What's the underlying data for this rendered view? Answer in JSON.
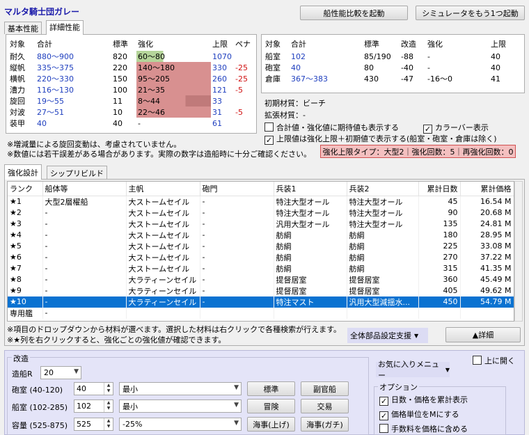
{
  "app_title": "マルタ騎士団ガレー",
  "top_buttons": {
    "compare": "船性能比較を起動",
    "simulator": "シミュレータをもう1つ起動"
  },
  "perf_tabs": [
    "基本性能",
    "詳細性能"
  ],
  "stats": {
    "headers": [
      "対象",
      "合計",
      "標準",
      "強化",
      "上限",
      "ペナ"
    ],
    "rows": [
      {
        "name": "耐久",
        "total": "880～900",
        "std": "820",
        "enh": "60～80",
        "cap": "1070",
        "pen": "",
        "bar": 0.36,
        "color": "green"
      },
      {
        "name": "縦帆",
        "total": "335～375",
        "std": "220",
        "enh": "140～180",
        "cap": "330",
        "pen": "-25",
        "bar": 1.0,
        "color": "red"
      },
      {
        "name": "横帆",
        "total": "220～330",
        "std": "150",
        "enh": "95～205",
        "cap": "260",
        "pen": "-25",
        "bar": 1.0,
        "color": "red"
      },
      {
        "name": "漕力",
        "total": "116～130",
        "std": "100",
        "enh": "21～35",
        "cap": "121",
        "pen": "-5",
        "bar": 1.0,
        "color": "red"
      },
      {
        "name": "旋回",
        "total": "19～55",
        "std": "11",
        "enh": "8～44",
        "cap": "33",
        "pen": "",
        "bar": 0.66,
        "color": "red"
      },
      {
        "name": "対波",
        "total": "27～51",
        "std": "10",
        "enh": "22～46",
        "cap": "31",
        "pen": "-5",
        "bar": 1.0,
        "color": "red"
      },
      {
        "name": "装甲",
        "total": "40",
        "std": "40",
        "enh": "-",
        "cap": "61",
        "pen": "",
        "bar": 0,
        "color": "none"
      }
    ]
  },
  "notes_top": [
    "※増減量による旋回変動は、考慮されていません。",
    "※数値には若干誤差がある場合があります。実際の数字は造船時に十分ご確認ください。"
  ],
  "capacity": {
    "headers": [
      "対象",
      "合計",
      "標準",
      "改造",
      "強化",
      "上限"
    ],
    "rows": [
      {
        "name": "船室",
        "total": "102",
        "std": "85/190",
        "mod": "-88",
        "enh": "-",
        "cap": "40"
      },
      {
        "name": "砲室",
        "total": "40",
        "std": "80",
        "mod": "-40",
        "enh": "-",
        "cap": "40"
      },
      {
        "name": "倉庫",
        "total": "367～383",
        "std": "430",
        "mod": "-47",
        "enh": "-16～0",
        "cap": "41"
      }
    ]
  },
  "material": {
    "initial_label": "初期材質：",
    "initial_value": "ビーチ",
    "ext_label": "拡張材質：",
    "ext_value": "-"
  },
  "options_top": {
    "expect": "合計値・強化値に期待値も表示する",
    "colorbar": "カラーバー表示",
    "capmode": "上限値は強化上限＋初期値で表示する(船室・砲室・倉庫は除く)"
  },
  "enh_info": "強化上限タイプ：大型2｜強化回数：5｜再強化回数：0",
  "enh_tabs": [
    "強化設計",
    "シップリビルド"
  ],
  "grid": {
    "headers": [
      "ランク",
      "船体等",
      "主帆",
      "砲門",
      "兵装1",
      "兵装2",
      "累計日数",
      "累計価格"
    ],
    "rows": [
      [
        "★1",
        "大型2層櫂船",
        "大ストームセイル",
        "-",
        "特注大型オール",
        "特注大型オール",
        "45",
        "16.54 M"
      ],
      [
        "★2",
        "-",
        "大ストームセイル",
        "-",
        "特注大型オール",
        "特注大型オール",
        "90",
        "20.68 M"
      ],
      [
        "★3",
        "-",
        "大ストームセイル",
        "-",
        "汎用大型オール",
        "特注大型オール",
        "135",
        "24.81 M"
      ],
      [
        "★4",
        "-",
        "大ストームセイル",
        "-",
        "舫綱",
        "舫綱",
        "180",
        "28.95 M"
      ],
      [
        "★5",
        "-",
        "大ストームセイル",
        "-",
        "舫綱",
        "舫綱",
        "225",
        "33.08 M"
      ],
      [
        "★6",
        "-",
        "大ストームセイル",
        "-",
        "舫綱",
        "舫綱",
        "270",
        "37.22 M"
      ],
      [
        "★7",
        "-",
        "大ストームセイル",
        "-",
        "舫綱",
        "舫綱",
        "315",
        "41.35 M"
      ],
      [
        "★8",
        "-",
        "大ラティーンセイル",
        "-",
        "提督居室",
        "提督居室",
        "360",
        "45.49 M"
      ],
      [
        "★9",
        "-",
        "大ラティーンセイル",
        "-",
        "提督居室",
        "提督居室",
        "405",
        "49.62 M"
      ],
      [
        "★10",
        "-",
        "大ラティーンセイル",
        "-",
        "特注マスト",
        "汎用大型減揺水...",
        "450",
        "54.79 M"
      ],
      [
        "専用艦",
        "-",
        "",
        "",
        "",
        "",
        "",
        ""
      ]
    ]
  },
  "notes_bottom": [
    "※項目のドロップダウンから材料が選べます。選択した材料は右クリックで各種検索が行えます。",
    "※★列を右クリックすると、強化ごとの強化値が確認できます。"
  ],
  "support_button": "全体部品設定支援",
  "detail_button": "▲詳細",
  "mod": {
    "title": "改造",
    "ship_r_label": "造船R",
    "ship_r_value": "20",
    "rows": [
      {
        "label": "砲室 (40-120)",
        "value": "40",
        "select": "最小",
        "b1": "標準",
        "b2": "副官船"
      },
      {
        "label": "船室 (102-285)",
        "value": "102",
        "select": "最小",
        "b1": "冒険",
        "b2": "交易"
      },
      {
        "label": "容量 (525-875)",
        "value": "525",
        "select": "-25%",
        "b1": "海事(上げ)",
        "b2": "海事(ガチ)"
      }
    ]
  },
  "right_panel": {
    "top_open": "上に開く",
    "fav_menu": "お気に入りメニュー",
    "options_label": "オプション",
    "opts": [
      "日数・価格を累計表示",
      "価格単位をMにする",
      "手数料を価格に含める"
    ]
  },
  "colors": {
    "title": "#1a1aaa",
    "bar_red": "#d89090",
    "bar_green": "#b5d59a",
    "info_bg": "#f4c0c0",
    "info_border": "#d05050",
    "select": "#0a72d1",
    "lower_bg": "#e4e4f8"
  }
}
